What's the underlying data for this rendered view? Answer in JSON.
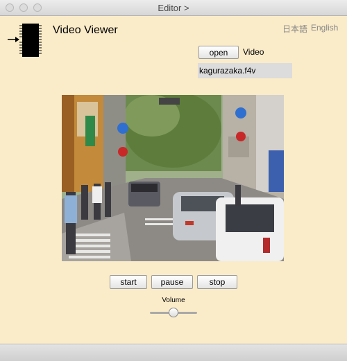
{
  "window": {
    "title": "Editor >"
  },
  "header": {
    "app_title": "Video Viewer",
    "lang_ja": "日本語",
    "lang_en": "English"
  },
  "source": {
    "open_label": "open",
    "video_label": "Video",
    "file_name": "kagurazaka.f4v"
  },
  "controls": {
    "start_label": "start",
    "pause_label": "pause",
    "stop_label": "stop",
    "volume_label": "Volume",
    "volume_level": 0.5
  },
  "icons": {
    "app_logo": "chip-icon"
  }
}
